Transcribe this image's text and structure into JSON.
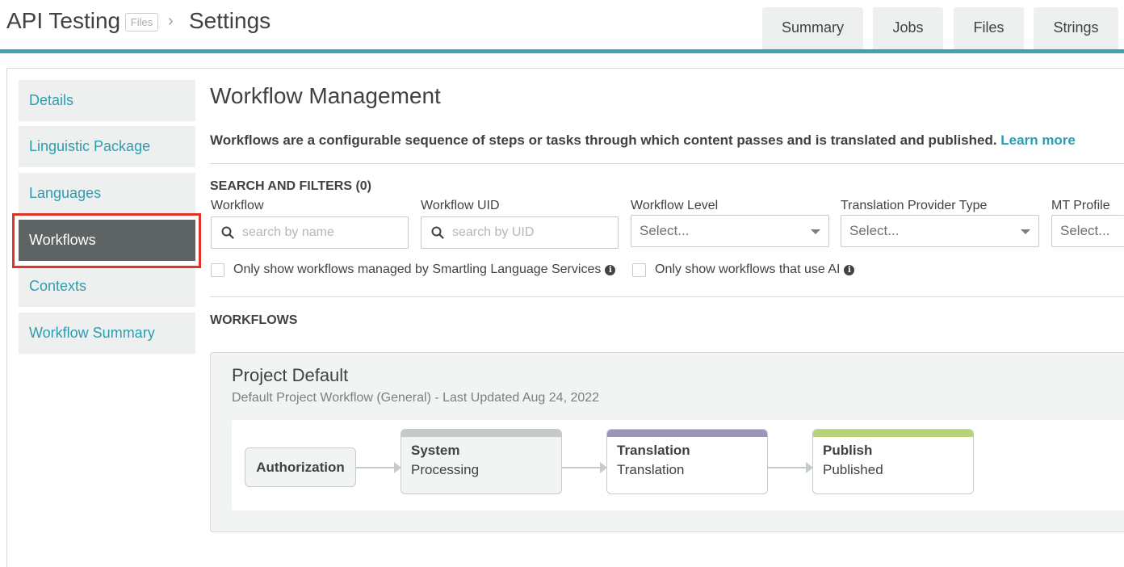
{
  "header": {
    "project_title": "API Testing",
    "files_badge": "Files",
    "breadcrumb_sep": "›",
    "page_title": "Settings",
    "tabs": [
      {
        "label": "Summary"
      },
      {
        "label": "Jobs"
      },
      {
        "label": "Files"
      },
      {
        "label": "Strings"
      }
    ]
  },
  "sidebar": {
    "items": [
      {
        "label": "Details"
      },
      {
        "label": "Linguistic Package"
      },
      {
        "label": "Languages"
      },
      {
        "label": "Workflows",
        "active": true
      },
      {
        "label": "Contexts"
      },
      {
        "label": "Workflow Summary"
      }
    ]
  },
  "main": {
    "title": "Workflow Management",
    "description": "Workflows are a configurable sequence of steps or tasks through which content passes and is translated and published.",
    "learn_more": "Learn more",
    "filters": {
      "heading": "SEARCH AND FILTERS (0)",
      "workflow_label": "Workflow",
      "workflow_placeholder": "search by name",
      "uid_label": "Workflow UID",
      "uid_placeholder": "search by UID",
      "level_label": "Workflow Level",
      "level_value": "Select...",
      "provider_label": "Translation Provider Type",
      "provider_value": "Select...",
      "mt_label": "MT Profile",
      "mt_value": "Select...",
      "check_managed": "Only show workflows managed by Smartling Language Services",
      "check_ai": "Only show workflows that use AI"
    },
    "workflows_heading": "WORKFLOWS",
    "workflow": {
      "name": "Project Default",
      "subtitle": "Default Project Workflow (General) - Last Updated Aug 24, 2022",
      "steps": [
        {
          "title": "Authorization"
        },
        {
          "title": "System",
          "sub": "Processing",
          "color": "#c4c9c9"
        },
        {
          "title": "Translation",
          "sub": "Translation",
          "color": "#9b96b8"
        },
        {
          "title": "Publish",
          "sub": "Published",
          "color": "#b9d27a"
        }
      ]
    }
  },
  "colors": {
    "accent": "#3ba4b5",
    "link": "#2c9db1",
    "active_sidebar": "#5e6463",
    "highlight": "#e0332b"
  }
}
